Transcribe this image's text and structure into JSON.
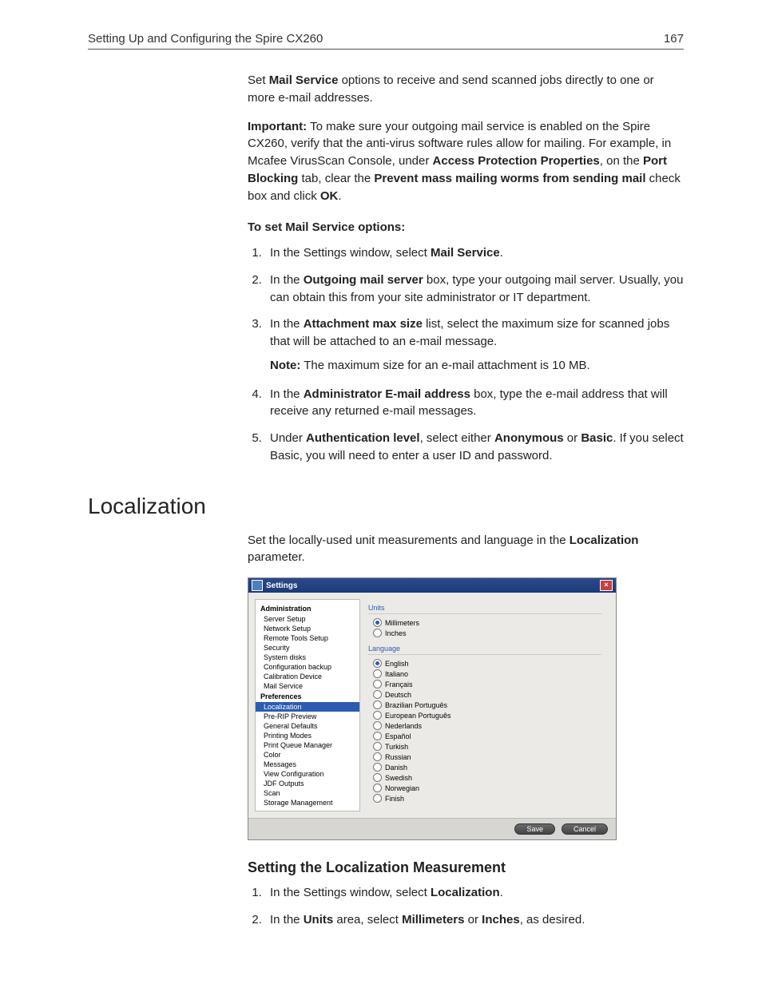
{
  "header": {
    "title": "Setting Up and Configuring the Spire CX260",
    "page_number": "167"
  },
  "intro": {
    "prefix": "Set ",
    "bold1": "Mail Service",
    "suffix": " options to receive and send scanned jobs directly to one or more e-mail addresses."
  },
  "important": {
    "label": "Important:",
    "t1": "  To make sure your outgoing mail service is enabled on the Spire CX260, verify that the anti-virus software rules allow for mailing. For example, in Mcafee VirusScan Console, under ",
    "b1": "Access Protection Properties",
    "t2": ", on the ",
    "b2": "Port Blocking",
    "t3": " tab, clear the ",
    "b3": "Prevent mass mailing worms from sending mail",
    "t4": " check box and click ",
    "b4": "OK",
    "t5": "."
  },
  "set_heading": "To set Mail Service options:",
  "steps_a": {
    "s1a": "In the Settings window, select ",
    "s1b": "Mail Service",
    "s1c": ".",
    "s2a": "In the ",
    "s2b": "Outgoing mail server",
    "s2c": " box, type your outgoing mail server. Usually, you can obtain this from your site administrator or IT department.",
    "s3a": "In the ",
    "s3b": "Attachment max size",
    "s3c": " list, select the maximum size for scanned jobs that will be attached to an e-mail message.",
    "s3note_label": "Note:",
    "s3note_text": "  The maximum size for an e-mail attachment is 10 MB.",
    "s4a": "In the ",
    "s4b": "Administrator E-mail address",
    "s4c": " box, type the e-mail address that will receive any returned e-mail messages.",
    "s5a": "Under ",
    "s5b": "Authentication level",
    "s5c": ", select either ",
    "s5d": "Anonymous",
    "s5e": " or ",
    "s5f": "Basic",
    "s5g": ". If you select Basic, you will need to enter a user ID and password."
  },
  "localization": {
    "heading": "Localization",
    "intro_a": "Set the locally-used unit measurements and language in the ",
    "intro_b": "Localization",
    "intro_c": " parameter."
  },
  "dialog": {
    "title": "Settings",
    "nav_admin": "Administration",
    "nav_items_admin": [
      "Server Setup",
      "Network Setup",
      "Remote Tools Setup",
      "Security",
      "System disks",
      "Configuration backup",
      "Calibration Device",
      "Mail Service"
    ],
    "nav_prefs": "Preferences",
    "nav_items_prefs": [
      "Localization",
      "Pre-RIP Preview",
      "General Defaults",
      "Printing Modes",
      "Print Queue Manager",
      "Color",
      "Messages",
      "View Configuration",
      "JDF Outputs",
      "Scan",
      "Storage Management"
    ],
    "selected_nav": "Localization",
    "units_label": "Units",
    "units": [
      "Millimeters",
      "Inches"
    ],
    "units_selected": "Millimeters",
    "lang_label": "Language",
    "langs": [
      "English",
      "Italiano",
      "Français",
      "Deutsch",
      "Brazilian Português",
      "European Português",
      "Nederlands",
      "Español",
      "Turkish",
      "Russian",
      "Danish",
      "Swedish",
      "Norwegian",
      "Finish"
    ],
    "lang_selected": "English",
    "save": "Save",
    "cancel": "Cancel"
  },
  "sub_measure": {
    "heading": "Setting the Localization Measurement",
    "s1a": "In the Settings window, select ",
    "s1b": "Localization",
    "s1c": ".",
    "s2a": "In the ",
    "s2b": "Units",
    "s2c": " area, select ",
    "s2d": "Millimeters",
    "s2e": " or ",
    "s2f": "Inches",
    "s2g": ", as desired."
  }
}
